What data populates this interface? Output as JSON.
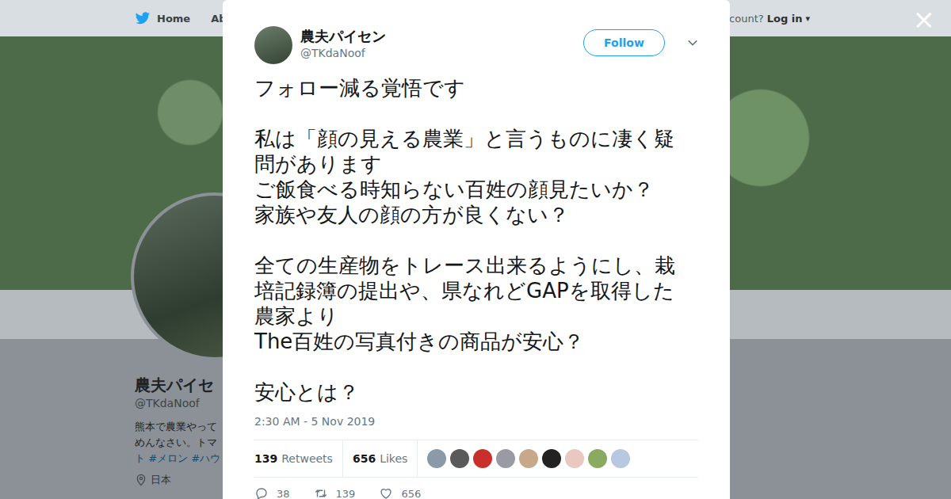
{
  "nav": {
    "home": "Home",
    "about": "Abo",
    "account": "ccount?",
    "login": "Log in",
    "login_caret": "▾"
  },
  "close": "×",
  "profile": {
    "name": "農夫パイセ",
    "handle": "@TKdaNoof",
    "bio": [
      {
        "text": "熊本で農業やって",
        "link": false
      },
      {
        "text": "めんなさい。トマ",
        "link": false
      },
      {
        "text": "ト #メロン #ハウ",
        "link": true
      }
    ],
    "location": "日本"
  },
  "tweet": {
    "name": "農夫パイセン",
    "handle": "@TKdaNoof",
    "follow": "Follow",
    "text": "フォロー減る覚悟です\n\n私は「顔の見える農業」と言うものに凄く疑問があります\nご飯食べる時知らない百姓の顔見たいか？\n家族や友人の顔の方が良くない？\n\n全ての生産物をトレース出来るようにし、栽培記録簿の提出や、県なれどGAPを取得した農家より\nThe百姓の写真付きの商品が安心？\n\n安心とは？",
    "time": "2:30 AM - 5 Nov 2019",
    "stats": [
      {
        "count": "139",
        "label": "Retweets"
      },
      {
        "count": "656",
        "label": "Likes"
      }
    ],
    "likers": [
      {
        "color": "#8a9aa8"
      },
      {
        "color": "#5a5a5a"
      },
      {
        "color": "#c9302c"
      },
      {
        "color": "#9a9aa4"
      },
      {
        "color": "#c8a88a"
      },
      {
        "color": "#222222"
      },
      {
        "color": "#e8c8c0"
      },
      {
        "color": "#8aaa60"
      },
      {
        "color": "#b8c8e0"
      }
    ],
    "actions": [
      {
        "kind": "reply",
        "count": "38"
      },
      {
        "kind": "retweet",
        "count": "139"
      },
      {
        "kind": "like",
        "count": "656"
      }
    ]
  }
}
